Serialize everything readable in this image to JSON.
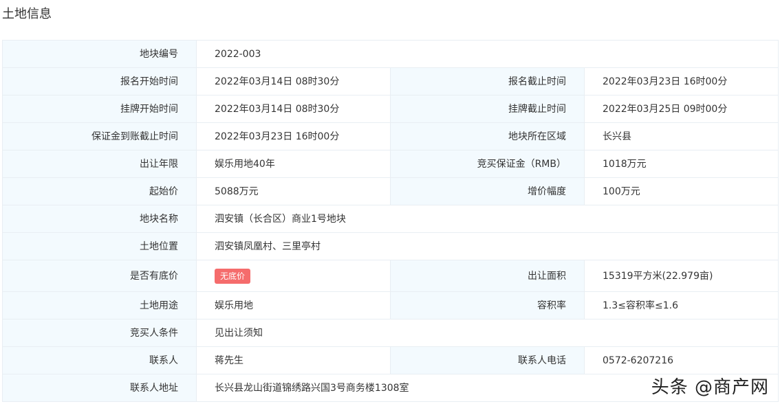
{
  "section": {
    "title": "土地信息"
  },
  "rows": [
    {
      "label": "地块编号",
      "value": "2022-003"
    },
    {
      "label": "报名开始时间",
      "value": "2022年03月14日 08时30分",
      "label2": "报名截止时间",
      "value2": "2022年03月23日 16时00分"
    },
    {
      "label": "挂牌开始时间",
      "value": "2022年03月14日 08时30分",
      "label2": "挂牌截止时间",
      "value2": "2022年03月25日 09时00分"
    },
    {
      "label": "保证金到账截止时间",
      "value": "2022年03月23日 16时00分",
      "label2": "地块所在区域",
      "value2": "长兴县"
    },
    {
      "label": "出让年限",
      "value": "娱乐用地40年",
      "label2": "竞买保证金（RMB）",
      "value2": "1018万元"
    },
    {
      "label": "起始价",
      "value": "5088万元",
      "label2": "增价幅度",
      "value2": "100万元"
    },
    {
      "label": "地块名称",
      "value": "泗安镇（长合区）商业1号地块"
    },
    {
      "label": "土地位置",
      "value": "泗安镇凤凰村、三里亭村"
    },
    {
      "label": "是否有底价",
      "badge": "无底价",
      "badge_color": "#f56c6c",
      "label2": "出让面积",
      "value2": "15319平方米(22.979亩)"
    },
    {
      "label": "土地用途",
      "value": "娱乐用地",
      "label2": "容积率",
      "value2": "1.3≤容积率≤1.6"
    },
    {
      "label": "竞买人条件",
      "value": "见出让须知"
    },
    {
      "label": "联系人",
      "value": "蒋先生",
      "label2": "联系人电话",
      "value2": "0572-6207216"
    },
    {
      "label": "联系人地址",
      "value": "长兴县龙山街道锦绣路兴国3号商务楼1308室"
    }
  ],
  "watermark": {
    "text": "头条 @商产网"
  },
  "colors": {
    "label_bg": "#f3fafe",
    "border": "#e8eef3",
    "badge": "#f56c6c"
  }
}
